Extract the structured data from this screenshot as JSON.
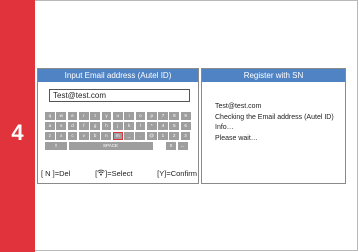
{
  "step": {
    "number": "4"
  },
  "left_panel": {
    "title": "Input Email address (Autel ID)",
    "email_value": "Test@test.com",
    "keyboard": {
      "rows": [
        [
          "q",
          "w",
          "e",
          "r",
          "t",
          "y",
          "u",
          "i",
          "o",
          "p",
          "7",
          "8",
          "9"
        ],
        [
          "a",
          "s",
          "d",
          "f",
          "g",
          "h",
          "j",
          "k",
          "l",
          "*",
          "4",
          "5",
          "6"
        ],
        [
          "z",
          "x",
          "c",
          "v",
          "b",
          "n",
          "m",
          "_",
          ".",
          "@",
          "1",
          "2",
          "3"
        ],
        [
          "⇧",
          "SPACE",
          "0",
          "←"
        ]
      ],
      "selected_key": "m"
    },
    "footer": {
      "del": "[ N ]=Del",
      "select_prefix": "[",
      "select_suffix": "]=Select",
      "confirm": "[Y]=Confirm"
    }
  },
  "right_panel": {
    "title": "Register with SN",
    "lines": [
      "Test@test.com",
      "Checking the Email address (Autel ID)",
      "Info…",
      "Please wait…"
    ]
  },
  "colors": {
    "accent_red": "#e1333b",
    "header_blue": "#4f83c4",
    "key_gray": "#9e9e9e"
  }
}
